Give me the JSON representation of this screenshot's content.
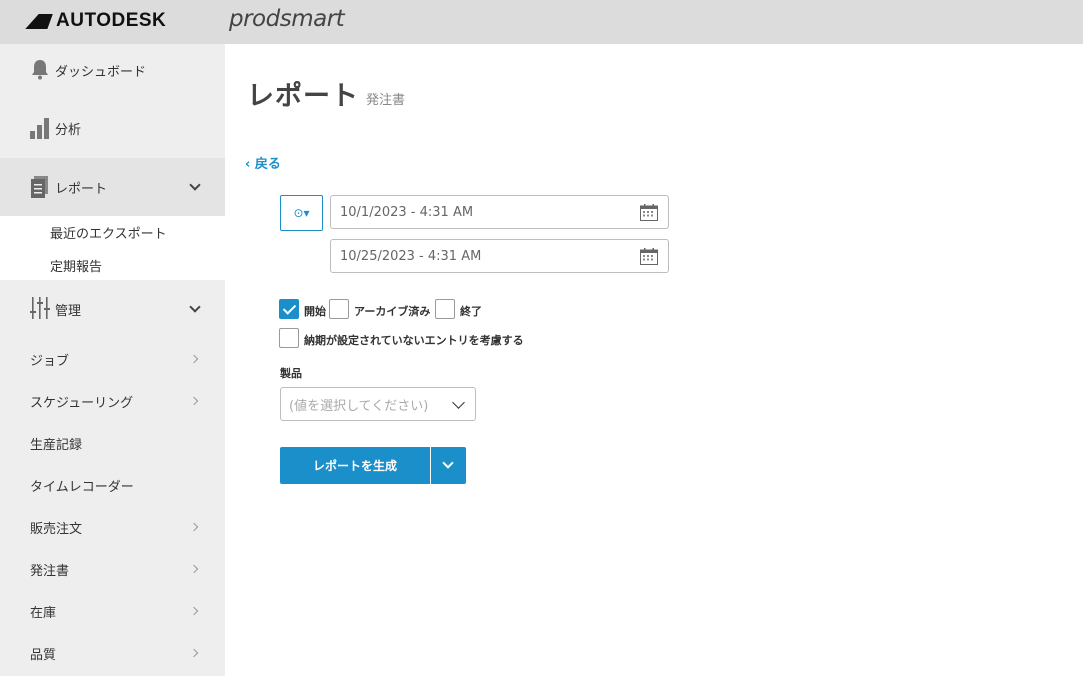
{
  "brand": {
    "autodesk": "AUTODESK",
    "product": "prodsmart"
  },
  "sidebar": {
    "items": [
      {
        "label": "ダッシュボード",
        "icon": "bell-icon"
      },
      {
        "label": "分析",
        "icon": "bar-chart-icon"
      },
      {
        "label": "レポート",
        "icon": "document-icon",
        "expanded": true
      },
      {
        "label": "管理",
        "icon": "sliders-icon",
        "expanded": true
      },
      {
        "label": "ジョブ"
      },
      {
        "label": "スケジューリング"
      },
      {
        "label": "生産記録"
      },
      {
        "label": "タイムレコーダー"
      },
      {
        "label": "販売注文"
      },
      {
        "label": "発注書"
      },
      {
        "label": "在庫"
      },
      {
        "label": "品質"
      }
    ],
    "report_sub": [
      "最近のエクスポート",
      "定期報告"
    ]
  },
  "main": {
    "title": "レポート",
    "subtitle": "発注書",
    "back": "‹ 戻る",
    "mode_icon": "⊙▾",
    "date_from": "10/1/2023 - 4:31 AM",
    "date_to": "10/25/2023 - 4:31 AM",
    "checkboxes": [
      {
        "label": "開始",
        "checked": true
      },
      {
        "label": "アーカイブ済み",
        "checked": false
      },
      {
        "label": "終了",
        "checked": false
      },
      {
        "label": "納期が設定されていないエントリを考慮する",
        "checked": false
      }
    ],
    "product_label": "製品",
    "product_placeholder": "(値を選択してください)",
    "generate_label": "レポートを生成"
  },
  "colors": {
    "accent": "#1a8fc9",
    "topbar": "#dcdcdc",
    "sidebar": "#eeeeee"
  }
}
